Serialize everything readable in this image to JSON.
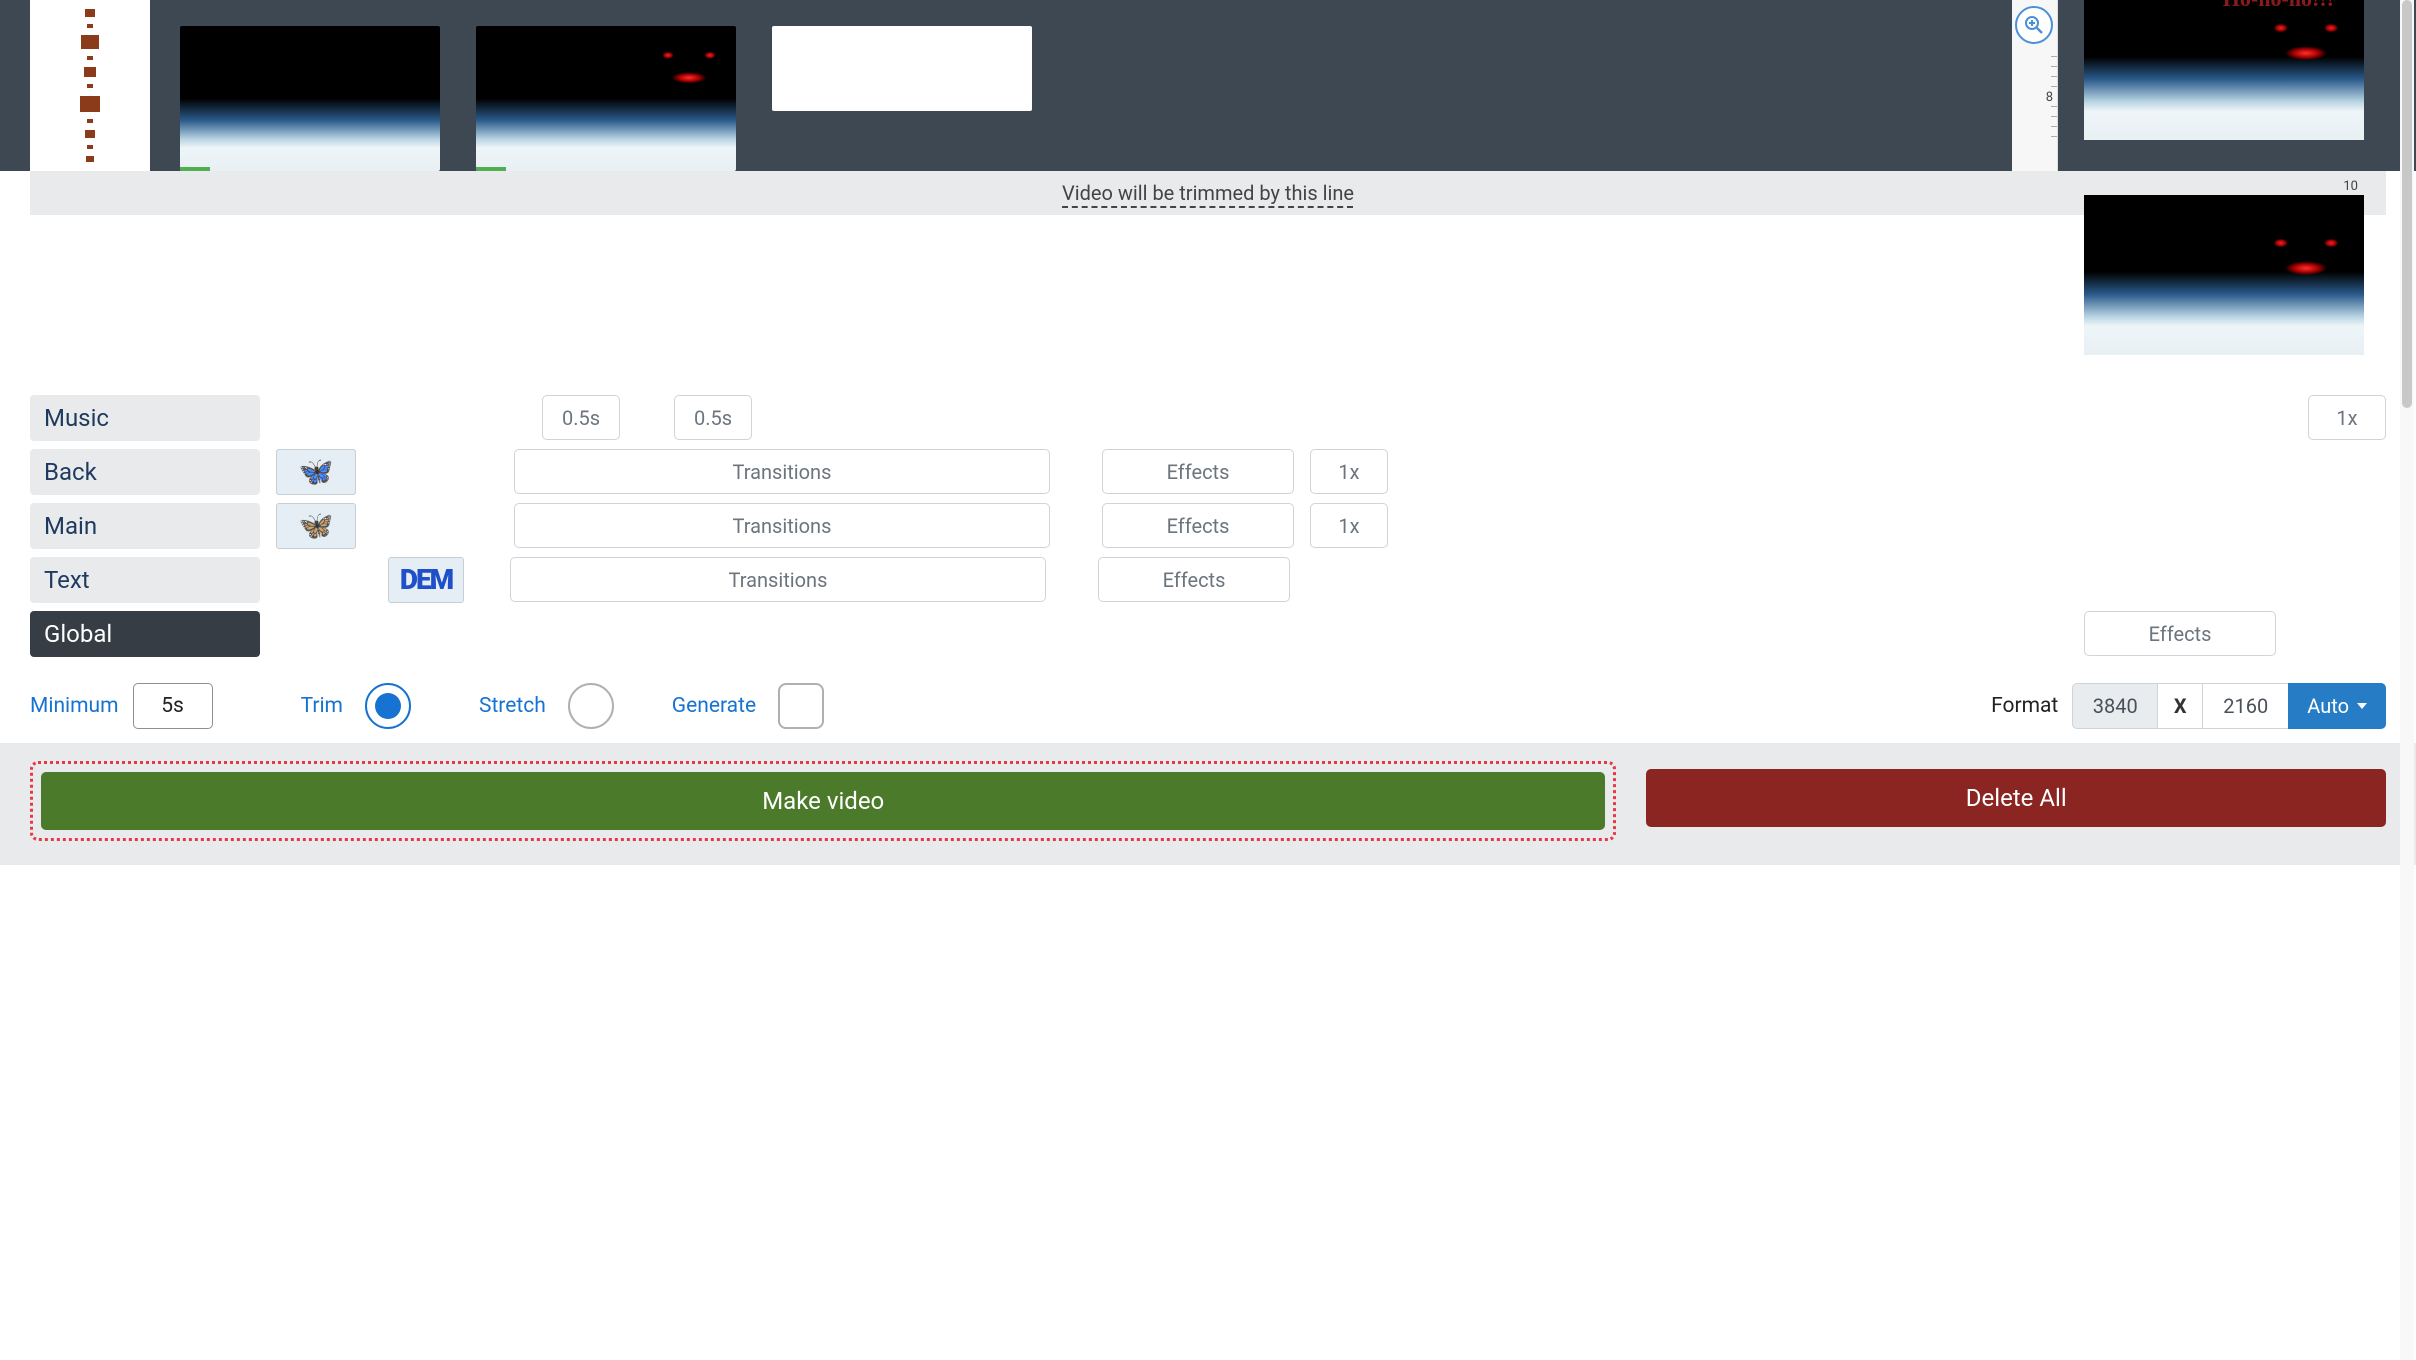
{
  "timeline": {
    "ruler_tick1": "8",
    "ruler_tick2": "10"
  },
  "trim_banner": "Video will be trimmed by this line",
  "preview": {
    "overlay_text": "Ho-ho-ho!!!"
  },
  "layers": {
    "music": {
      "label": "Music",
      "dur1": "0.5s",
      "dur2": "0.5s",
      "speed": "1x"
    },
    "back": {
      "label": "Back",
      "transitions": "Transitions",
      "effects": "Effects",
      "speed": "1x"
    },
    "main": {
      "label": "Main",
      "transitions": "Transitions",
      "effects": "Effects",
      "speed": "1x"
    },
    "text": {
      "label": "Text",
      "thumb_label": "DEM",
      "transitions": "Transitions",
      "effects": "Effects"
    },
    "global": {
      "label": "Global",
      "effects": "Effects"
    }
  },
  "controls": {
    "minimum_label": "Minimum",
    "minimum_value": "5s",
    "trim": "Trim",
    "stretch": "Stretch",
    "generate": "Generate",
    "format_label": "Format",
    "width": "3840",
    "x": "X",
    "height": "2160",
    "auto": "Auto"
  },
  "actions": {
    "make_video": "Make video",
    "delete_all": "Delete All"
  }
}
